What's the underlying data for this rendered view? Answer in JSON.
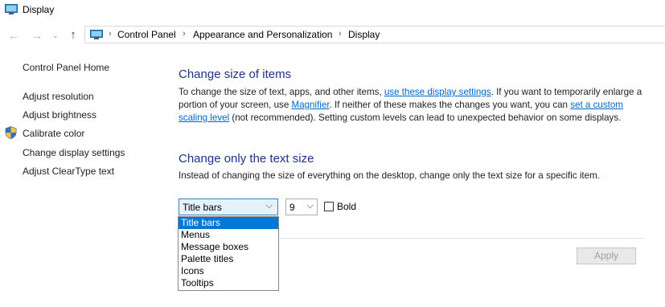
{
  "window": {
    "title": "Display"
  },
  "nav": {
    "back_icon": "←",
    "forward_icon": "→",
    "recent_icon": "⌄",
    "up_icon": "↑",
    "separator": "›",
    "breadcrumbs": [
      "Control Panel",
      "Appearance and Personalization",
      "Display"
    ]
  },
  "sidebar": {
    "home": "Control Panel Home",
    "items": [
      {
        "label": "Adjust resolution"
      },
      {
        "label": "Adjust brightness"
      },
      {
        "label": "Calibrate color"
      },
      {
        "label": "Change display settings"
      },
      {
        "label": "Adjust ClearType text"
      }
    ]
  },
  "section1": {
    "heading": "Change size of items",
    "text1": "To change the size of text, apps, and other items, ",
    "link1": "use these display settings",
    "text2": ".  If you want to temporarily enlarge a portion of your screen, use ",
    "link2": "Magnifier",
    "text3": ".  If neither of these makes the changes you want, you can ",
    "link3": "set a custom scaling level",
    "text4": " (not recommended).  Setting custom levels can lead to unexpected behavior on some displays."
  },
  "section2": {
    "heading": "Change only the text size",
    "description": "Instead of changing the size of everything on the desktop, change only the text size for a specific item."
  },
  "controls": {
    "item_selected": "Title bars",
    "item_options": [
      "Title bars",
      "Menus",
      "Message boxes",
      "Palette titles",
      "Icons",
      "Tooltips"
    ],
    "size_selected": "9",
    "arrow_icon": "⌵",
    "bold_label": "Bold",
    "apply_label": "Apply"
  },
  "colors": {
    "heading": "#1e3287",
    "link": "#0066cc",
    "selection": "#0078d7"
  }
}
